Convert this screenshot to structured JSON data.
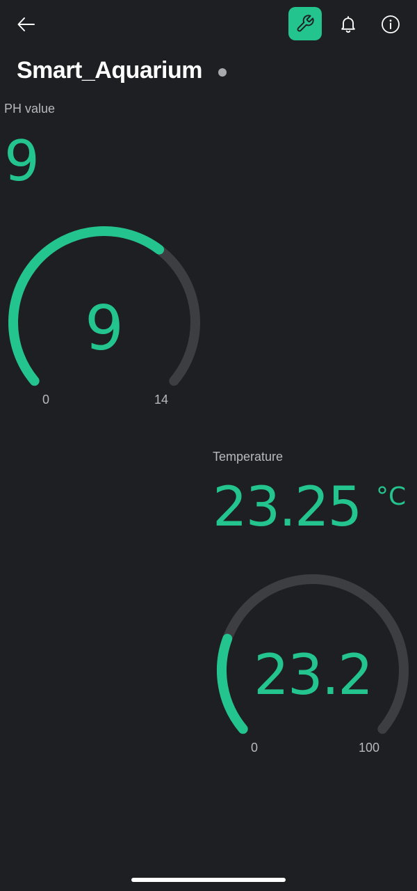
{
  "header": {
    "title": "Smart_Aquarium",
    "icons": {
      "back": "arrow-left-icon",
      "settings": "wrench-icon",
      "notifications": "bell-icon",
      "info": "info-icon"
    }
  },
  "colors": {
    "accent": "#23c48e",
    "track": "#3d3e42",
    "background": "#1e1f22",
    "label": "#b8b9bd",
    "status_dot": "#a8a9ad"
  },
  "widgets": {
    "ph": {
      "label": "PH value",
      "value": "9",
      "gauge": {
        "value": 9,
        "value_label": "9",
        "min": 0,
        "max": 14,
        "min_label": "0",
        "max_label": "14"
      }
    },
    "temperature": {
      "label": "Temperature",
      "value": "23.25",
      "unit": "°C",
      "gauge": {
        "value": 23.2,
        "value_label": "23.2",
        "min": 0,
        "max": 100,
        "min_label": "0",
        "max_label": "100"
      }
    }
  }
}
